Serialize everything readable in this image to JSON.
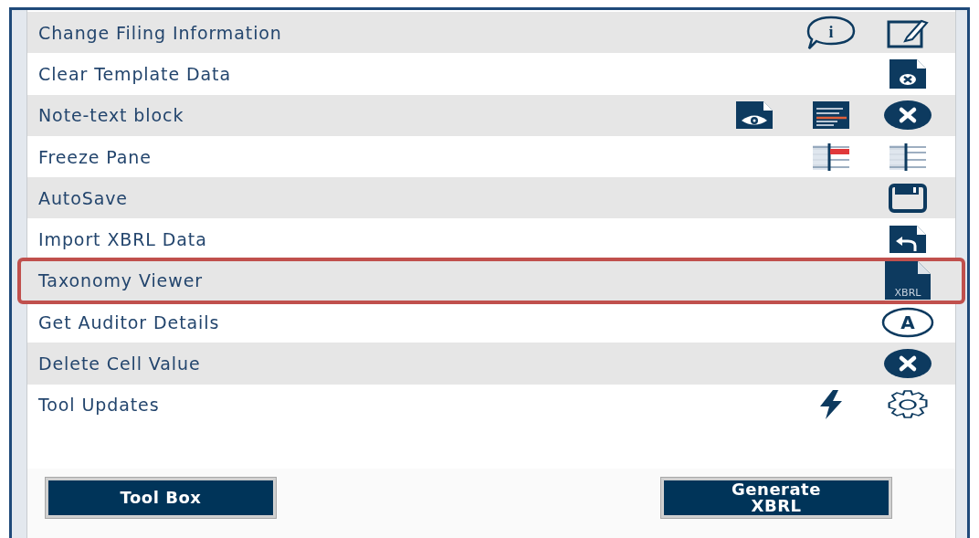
{
  "rows": [
    {
      "label": "Change Filing Information",
      "highlighted": false,
      "icons": [
        {
          "kind": "info",
          "text": "i"
        },
        {
          "kind": "edit"
        }
      ]
    },
    {
      "label": "Clear Template Data",
      "highlighted": false,
      "icons": [
        {
          "kind": "file-x"
        }
      ]
    },
    {
      "label": "Note-text block",
      "highlighted": false,
      "icons": [
        {
          "kind": "file-eye"
        },
        {
          "kind": "text-lines"
        },
        {
          "kind": "x-circle"
        }
      ]
    },
    {
      "label": "Freeze Pane",
      "highlighted": false,
      "icons": [
        {
          "kind": "freeze-marked"
        },
        {
          "kind": "freeze"
        }
      ]
    },
    {
      "label": "AutoSave",
      "highlighted": false,
      "icons": [
        {
          "kind": "save"
        }
      ]
    },
    {
      "label": "Import XBRL Data",
      "highlighted": false,
      "icons": [
        {
          "kind": "file-undo"
        }
      ]
    },
    {
      "label": "Taxonomy Viewer",
      "highlighted": true,
      "icons": [
        {
          "kind": "file-text",
          "text": "XBRL"
        }
      ]
    },
    {
      "label": "Get Auditor Details",
      "highlighted": false,
      "icons": [
        {
          "kind": "letter-circle",
          "text": "A"
        }
      ]
    },
    {
      "label": "Delete Cell Value",
      "highlighted": false,
      "icons": [
        {
          "kind": "x-circle"
        }
      ]
    },
    {
      "label": "Tool Updates",
      "highlighted": false,
      "icons": [
        {
          "kind": "bolt"
        },
        {
          "kind": "gear"
        }
      ]
    }
  ],
  "buttons": [
    {
      "label": "Tool Box"
    },
    {
      "label": "Generate XBRL"
    }
  ]
}
